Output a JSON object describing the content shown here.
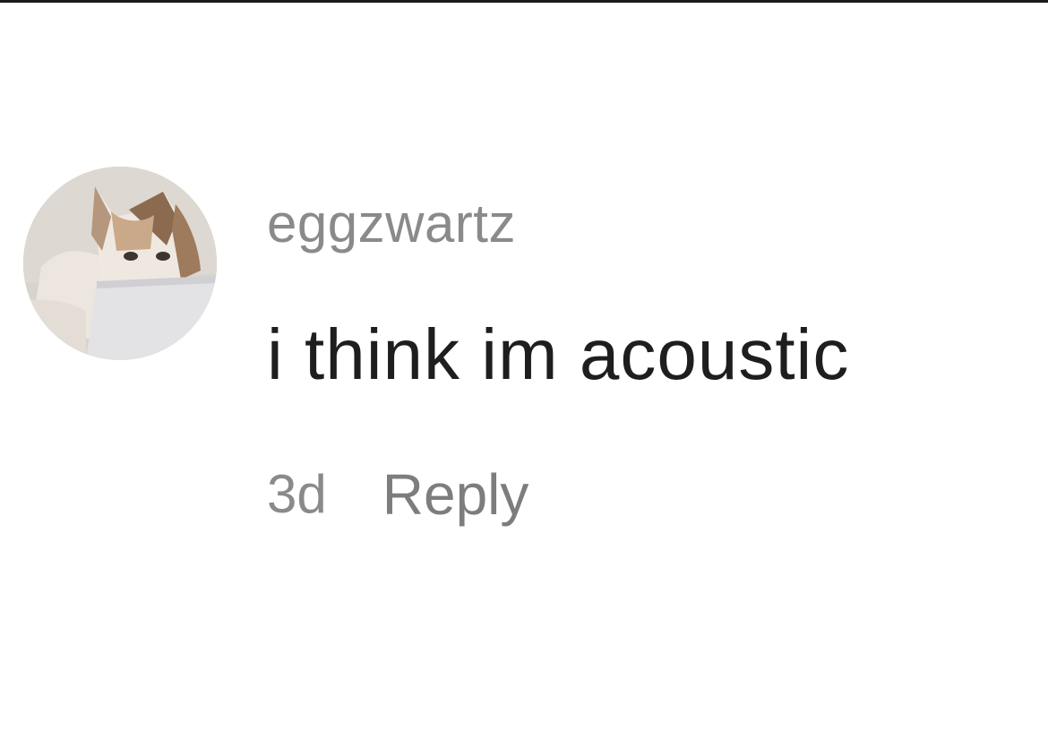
{
  "comment": {
    "username": "eggzwartz",
    "text": "i think im acoustic",
    "timestamp": "3d",
    "reply_label": "Reply",
    "avatar": {
      "subject": "cat-with-laptop-icon",
      "colors": {
        "background": "#d8d4cf",
        "fur_light": "#efe9e2",
        "fur_dark": "#8b6a4f",
        "laptop": "#e3e3e6"
      }
    }
  },
  "colors": {
    "username": "#8a8a8a",
    "text": "#1e1e1e",
    "meta": "#8a8a8a",
    "top_border": "#1a1a1a"
  }
}
